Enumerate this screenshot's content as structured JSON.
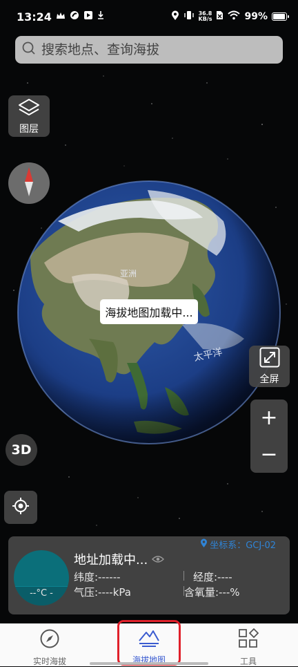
{
  "status_bar": {
    "time": "13:24",
    "net_speed_value": "36.8",
    "net_speed_unit": "KB/s",
    "battery": "99%",
    "battery_level": 0.99
  },
  "search": {
    "placeholder": "搜索地点、查询海拔"
  },
  "map_tools": {
    "layers_label": "图层",
    "mode_3d_label": "3D",
    "fullscreen_label": "全屏",
    "zoom_in": "+",
    "zoom_out": "−"
  },
  "map": {
    "loading_text": "海拔地图加载中...",
    "label_asia": "亚洲",
    "label_pacific": "太平洋"
  },
  "info_card": {
    "coord_system": "坐标系：GCJ-02",
    "temperature": "--°C -",
    "address": "地址加载中...",
    "latitude": "纬度:------",
    "longitude": "经度:----",
    "pressure": "气压:----kPa",
    "oxygen": "含氧量:---%"
  },
  "bottom_nav": {
    "items": [
      {
        "label": "实时海拔",
        "icon": "compass-icon"
      },
      {
        "label": "海拔地图",
        "icon": "mountain-icon"
      },
      {
        "label": "工具",
        "icon": "grid-icon"
      }
    ],
    "active_index": 1,
    "active_color": "#3a5bd0",
    "highlight_color": "#e0202a"
  }
}
